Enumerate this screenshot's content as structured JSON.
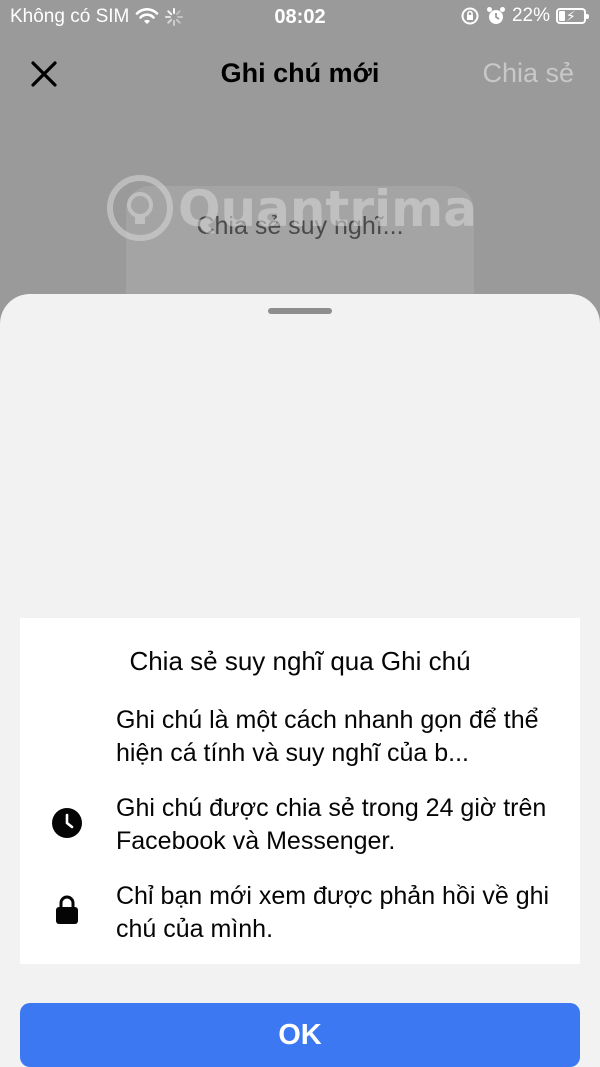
{
  "status_bar": {
    "carrier": "Không có SIM",
    "time": "08:02",
    "battery": "22%",
    "battery_level": 0.22
  },
  "header": {
    "title": "Ghi chú mới",
    "share_label": "Chia sẻ"
  },
  "note": {
    "placeholder": "Chia sẻ suy nghĩ..."
  },
  "watermark": {
    "text": "Quantrimang"
  },
  "sheet": {
    "title": "Chia sẻ suy nghĩ qua Ghi chú",
    "items": [
      {
        "icon": "none",
        "text": "Ghi chú là một cách nhanh gọn để thể hiện cá tính và suy nghĩ của b..."
      },
      {
        "icon": "clock-icon",
        "text": "Ghi chú được chia sẻ trong 24 giờ trên Facebook và Messenger."
      },
      {
        "icon": "lock-icon",
        "text": "Chỉ bạn mới xem được phản hồi về ghi chú của mình."
      }
    ],
    "ok_label": "OK"
  },
  "colors": {
    "dim_background": "#9a9a9a",
    "sheet_background": "#f2f2f2",
    "card_background": "#ffffff",
    "primary_button": "#3b78f2",
    "share_disabled": "#c8c8c8"
  }
}
